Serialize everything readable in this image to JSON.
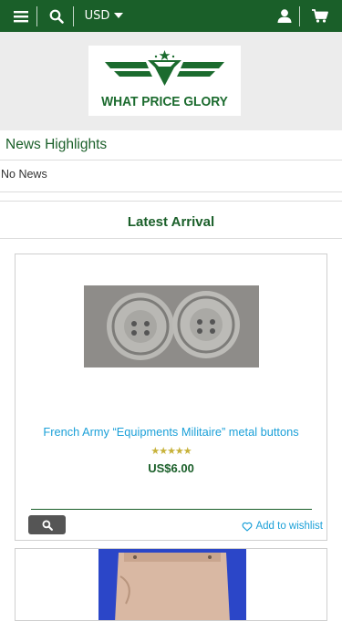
{
  "header": {
    "currency": "USD",
    "icons": [
      "menu-icon",
      "search-icon",
      "user-icon",
      "cart-icon"
    ]
  },
  "logo": {
    "text": "WHAT PRICE GLORY"
  },
  "news": {
    "title": "News Highlights",
    "empty_text": "No News"
  },
  "latest": {
    "title": "Latest Arrival",
    "products": [
      {
        "name": "French Army “Equipments Militaire” metal buttons",
        "rating": "★★★★★",
        "price": "US$6.00",
        "wishlist_label": "Add to wishlist"
      }
    ]
  },
  "colors": {
    "brand_green": "#1a5f29",
    "link_blue": "#1ba0d8",
    "star_gold": "#c7b23a",
    "band_gray": "#ececec"
  }
}
